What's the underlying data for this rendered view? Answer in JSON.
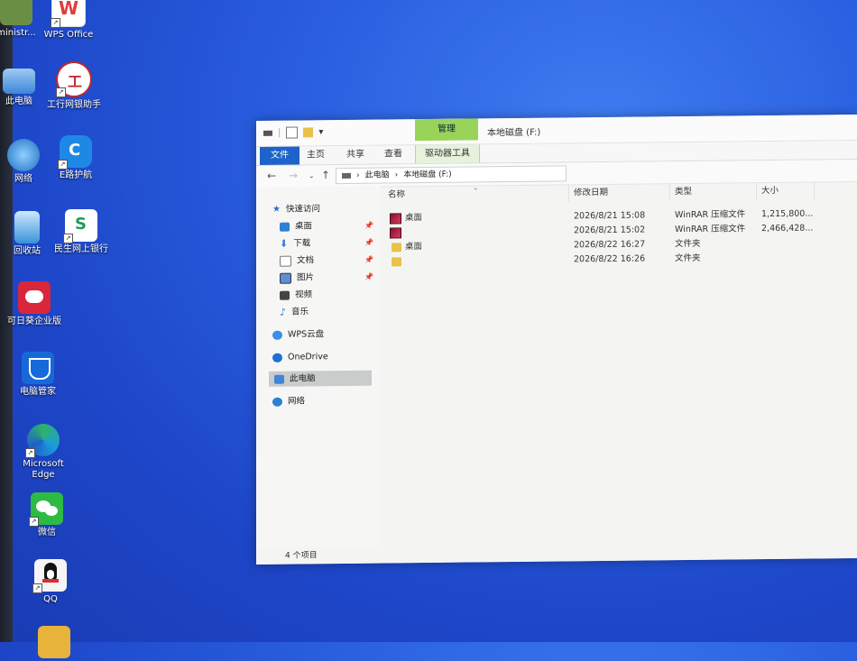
{
  "desktop": {
    "icons": [
      {
        "label": "ministr...",
        "color": "#6b8e45"
      },
      {
        "label": "WPS Office",
        "color": "#e33b3b"
      },
      {
        "label": "此电脑",
        "color": "#5aa0e6"
      },
      {
        "label": "工行网银助手",
        "color": "#c0272d"
      },
      {
        "label": "网络",
        "color": "#2f7fd3"
      },
      {
        "label": "E路护航",
        "color": "#1f88e5"
      },
      {
        "label": "回收站",
        "color": "#3a93d8"
      },
      {
        "label": "民生网上银行",
        "color": "#1f9a5b"
      },
      {
        "label": "可日葵企业版",
        "color": "#d9263b"
      },
      {
        "label": "电脑管家",
        "color": "#1669d8"
      },
      {
        "label": "Microsoft Edge",
        "color": "#1a9c84"
      },
      {
        "label": "微信",
        "color": "#2dbb44"
      },
      {
        "label": "QQ",
        "color": "#f5f5f5"
      }
    ]
  },
  "window": {
    "title": "本地磁盘 (F:)",
    "context_tab": "管理",
    "ribbon_tabs": [
      "文件",
      "主页",
      "共享",
      "查看",
      "驱动器工具"
    ],
    "path": [
      "此电脑",
      "本地磁盘 (F:)"
    ],
    "nav": {
      "quick_access": "快速访问",
      "quick_items": [
        "桌面",
        "下载",
        "文档",
        "图片",
        "视频",
        "音乐"
      ],
      "wps_cloud": "WPS云盘",
      "onedrive": "OneDrive",
      "this_pc": "此电脑",
      "network": "网络"
    },
    "columns": [
      "名称",
      "修改日期",
      "类型",
      "大小"
    ],
    "files": [
      {
        "name": "桌面",
        "date": "2026/8/21 15:08",
        "type": "WinRAR 压缩文件",
        "size": "1,215,800...",
        "kind": "rar"
      },
      {
        "name": "",
        "date": "2026/8/21 15:02",
        "type": "WinRAR 压缩文件",
        "size": "2,466,428...",
        "kind": "rar"
      },
      {
        "name": "桌面",
        "date": "2026/8/22 16:27",
        "type": "文件夹",
        "size": "",
        "kind": "dir"
      },
      {
        "name": "",
        "date": "2026/8/22 16:26",
        "type": "文件夹",
        "size": "",
        "kind": "dir"
      }
    ],
    "status": "4 个项目"
  },
  "colors": {
    "accent": "#1d63c9",
    "manage": "#9ad35a",
    "selected": "#c9cbcd"
  }
}
